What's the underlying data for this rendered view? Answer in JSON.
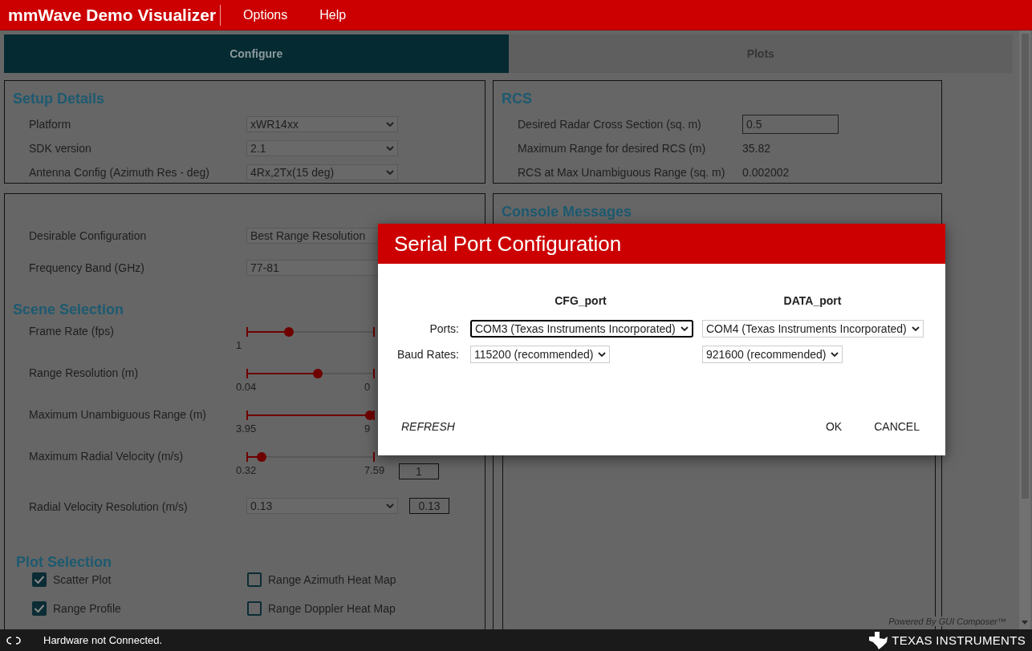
{
  "app": {
    "title": "mmWave Demo Visualizer",
    "menu": [
      "Options",
      "Help"
    ]
  },
  "tabs": [
    {
      "label": "Configure",
      "selected": true
    },
    {
      "label": "Plots",
      "selected": false
    }
  ],
  "setup_details": {
    "title": "Setup Details",
    "rows": [
      {
        "label": "Platform",
        "value": "xWR14xx"
      },
      {
        "label": "SDK version",
        "value": "2.1"
      },
      {
        "label": "Antenna Config (Azimuth Res - deg)",
        "value": "4Rx,2Tx(15 deg)"
      }
    ]
  },
  "configuration": {
    "rows": [
      {
        "label": "Desirable Configuration",
        "value": "Best Range Resolution"
      },
      {
        "label": "Frequency Band (GHz)",
        "value": "77-81"
      }
    ],
    "scene_title": "Scene Selection",
    "scene_rows": [
      {
        "kind": "slider",
        "label": "Frame Rate (fps)",
        "level": 0.32,
        "min_label": "1"
      },
      {
        "kind": "slider",
        "label": "Range Resolution (m)",
        "level": 0.56,
        "min_label": "0.04",
        "max_label": "0"
      },
      {
        "kind": "slider",
        "label": "Maximum Unambiguous Range (m)",
        "level": 1,
        "min_label": "3.95",
        "max_label": "9"
      },
      {
        "kind": "slider",
        "label": "Maximum Radial Velocity (m/s)",
        "level": 0.09,
        "min_label": "0.32",
        "max_label": "7.59",
        "readout": "1"
      },
      {
        "kind": "select",
        "label": "Radial Velocity Resolution (m/s)",
        "value": "0.13",
        "readout": "0.13"
      }
    ],
    "plot_title": "Plot Selection",
    "plots": [
      {
        "label": "Scatter Plot",
        "checked": true
      },
      {
        "label": "Range Azimuth Heat Map",
        "checked": false
      },
      {
        "label": "Range Profile",
        "checked": true
      },
      {
        "label": "Range Doppler Heat Map",
        "checked": false
      }
    ]
  },
  "rcs": {
    "title": "RCS",
    "rows": [
      {
        "kind": "input",
        "label": "Desired Radar Cross Section (sq. m)",
        "value": "0.5"
      },
      {
        "kind": "text",
        "label": "Maximum Range for desired RCS (m)",
        "value": "35.82"
      },
      {
        "kind": "text",
        "label": "RCS at Max Unambiguous Range (sq. m)",
        "value": "0.002002"
      }
    ]
  },
  "console": {
    "title": "Console Messages"
  },
  "dialog": {
    "title": "Serial Port Configuration",
    "columns": [
      "CFG_port",
      "DATA_port"
    ],
    "rows": [
      {
        "label": "Ports:",
        "fields": [
          {
            "value": "COM3 (Texas Instruments Incorporated)",
            "focused": true
          },
          {
            "value": "COM4 (Texas Instruments Incorporated)",
            "focused": false
          }
        ]
      },
      {
        "label": "Baud Rates:",
        "fields": [
          {
            "value": "115200 (recommended)",
            "focused": false
          },
          {
            "value": "921600 (recommended)",
            "focused": false
          }
        ]
      }
    ],
    "refresh": "REFRESH",
    "buttons": [
      "OK",
      "CANCEL"
    ]
  },
  "footer_note": "Powered By GUI Composer™",
  "status_bar": {
    "message": "Hardware not Connected.",
    "brand": "TEXAS INSTRUMENTS"
  }
}
